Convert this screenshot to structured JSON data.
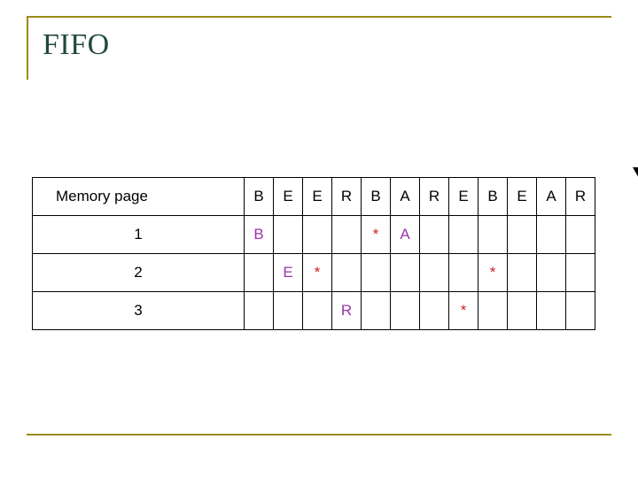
{
  "slide": {
    "title": "FIFO",
    "accent_color": "#9a8b13",
    "title_color": "#1f4a3c"
  },
  "arrow": {
    "name": "down-arrow-marker",
    "glyph": "↓"
  },
  "table": {
    "header_label": "Memory page",
    "sequence": [
      "B",
      "E",
      "E",
      "R",
      "B",
      "A",
      "R",
      "E",
      "B",
      "E",
      "A",
      "R"
    ],
    "rows": [
      {
        "label": "1",
        "cells": [
          "B",
          "",
          "",
          "",
          "*",
          "A",
          "",
          "",
          "",
          "",
          "",
          ""
        ]
      },
      {
        "label": "2",
        "cells": [
          "",
          "E",
          "*",
          "",
          "",
          "",
          "",
          "",
          "*",
          "",
          "",
          ""
        ]
      },
      {
        "label": "3",
        "cells": [
          "",
          "",
          "",
          "R",
          "",
          "",
          "",
          "*",
          "",
          "",
          "",
          ""
        ]
      }
    ],
    "colors": {
      "letter": "#9933aa",
      "star": "#cc2222",
      "border": "#000000"
    }
  }
}
